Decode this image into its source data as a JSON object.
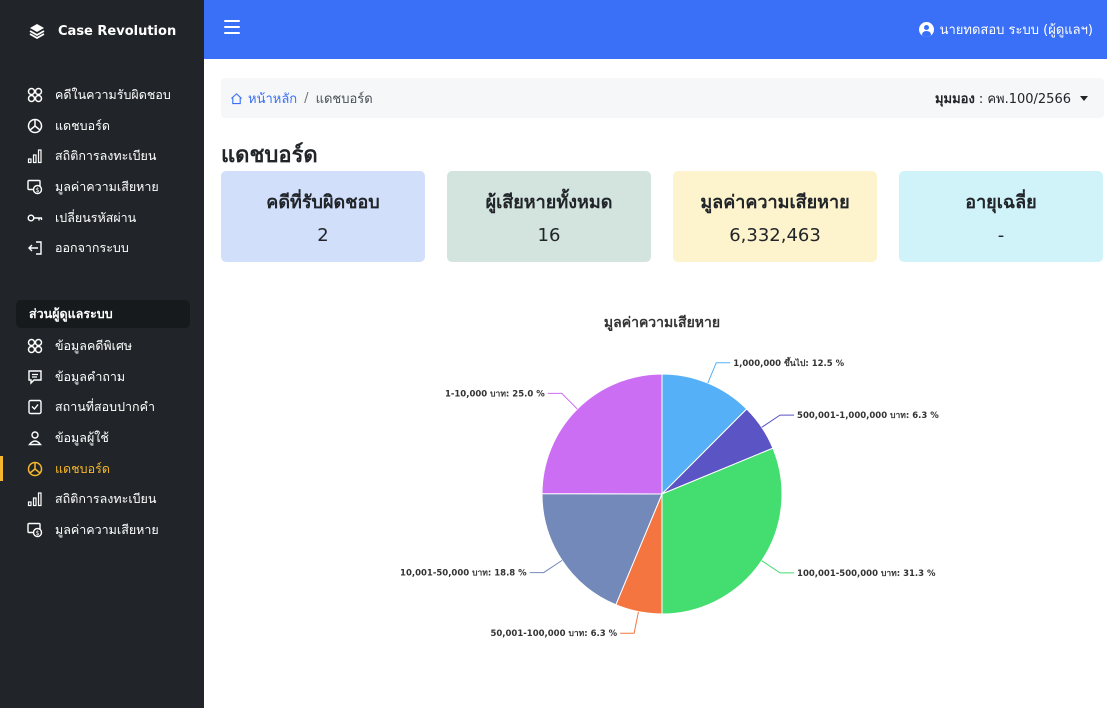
{
  "brand": {
    "name": "Case Revolution",
    "icon": "layers-icon"
  },
  "sidebar": {
    "top_items": [
      {
        "label": "คดีในความรับผิดชอบ",
        "icon": "cases-icon"
      },
      {
        "label": "แดชบอร์ด",
        "icon": "dashboard-icon"
      },
      {
        "label": "สถิติการลงทะเบียน",
        "icon": "bar-chart-icon"
      },
      {
        "label": "มูลค่าความเสียหาย",
        "icon": "money-icon"
      },
      {
        "label": "เปลี่ยนรหัสผ่าน",
        "icon": "key-icon"
      },
      {
        "label": "ออกจากระบบ",
        "icon": "logout-icon"
      }
    ],
    "section_label": "ส่วนผู้ดูแลระบบ",
    "admin_items": [
      {
        "label": "ข้อมูลคดีพิเศษ",
        "icon": "cases-icon"
      },
      {
        "label": "ข้อมูลคำถาม",
        "icon": "comment-icon"
      },
      {
        "label": "สถานที่สอบปากคำ",
        "icon": "location-icon"
      },
      {
        "label": "ข้อมูลผู้ใช้",
        "icon": "user-icon"
      },
      {
        "label": "แดชบอร์ด",
        "icon": "dashboard-icon",
        "active": true
      },
      {
        "label": "สถิติการลงทะเบียน",
        "icon": "bar-chart-icon"
      },
      {
        "label": "มูลค่าความเสียหาย",
        "icon": "money-icon"
      }
    ],
    "active_color": "#f5b72b"
  },
  "topbar": {
    "user_label": "นายทดสอบ ระบบ (ผู้ดูแลฯ)",
    "color": "#3a6ff7"
  },
  "breadcrumb": {
    "home": "หน้าหลัก",
    "separator": "/",
    "current": "แดชบอร์ด"
  },
  "view": {
    "label": "มุมมอง",
    "value": ": คพ.100/2566"
  },
  "page_title": "แดชบอร์ด",
  "cards": [
    {
      "label": "คดีที่รับผิดชอบ",
      "value": "2",
      "color": "#d1dffb"
    },
    {
      "label": "ผู้เสียหายทั้งหมด",
      "value": "16",
      "color": "#d2e4dd"
    },
    {
      "label": "มูลค่าความเสียหาย",
      "value": "6,332,463",
      "color": "#fdf3cd"
    },
    {
      "label": "อายุเฉลี่ย",
      "value": "-",
      "color": "#cff3f8"
    }
  ],
  "chart_data": {
    "type": "pie",
    "title": "มูลค่าความเสียหาย",
    "labels": [
      "1,000,000 ขึ้นไป",
      "500,001-1,000,000 บาท",
      "100,001-500,000 บาท",
      "50,001-100,000 บาท",
      "10,001-50,000 บาท",
      "1-10,000 บาท"
    ],
    "values": [
      12.5,
      6.3,
      31.3,
      6.3,
      18.8,
      25.0
    ],
    "display": [
      "1,000,000 ขึ้นไป: 12.5 %",
      "500,001-1,000,000 บาท: 6.3 %",
      "100,001-500,000 บาท: 31.3 %",
      "50,001-100,000 บาท: 6.3 %",
      "10,001-50,000 บาท: 18.8 %",
      "1-10,000 บาท: 25.0 %"
    ],
    "colors": [
      "#56b0f7",
      "#5a54c5",
      "#44dd6f",
      "#f47540",
      "#7389b9",
      "#cc6ef3"
    ],
    "legend": "none",
    "label_placement": "outside-with-leader-lines"
  }
}
